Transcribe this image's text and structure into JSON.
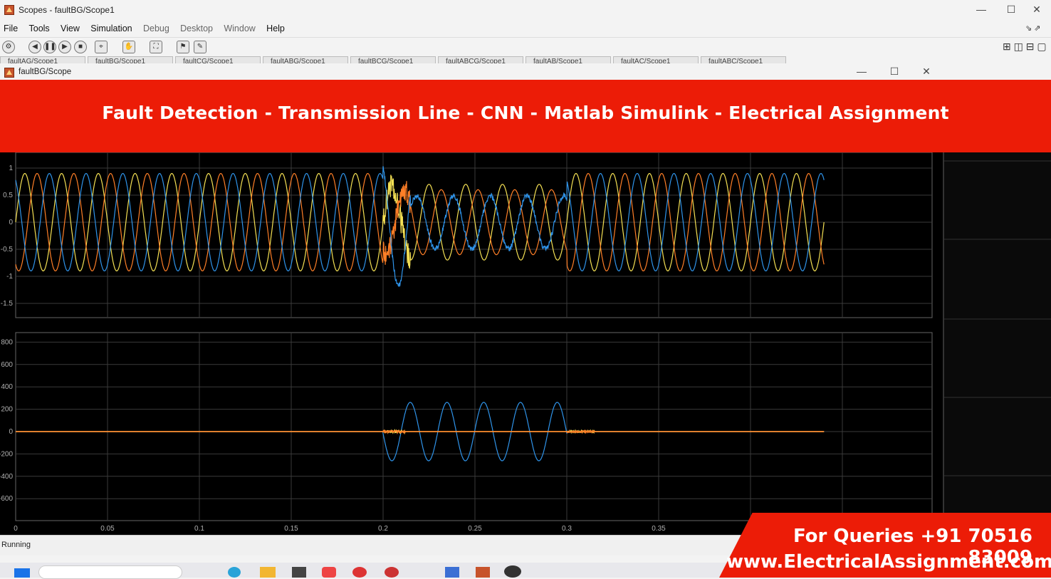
{
  "outer_window": {
    "title": "Scopes - faultBG/Scope1",
    "controls": {
      "minimize": "—",
      "maximize": "☐",
      "close": "✕"
    }
  },
  "menu": [
    "File",
    "Tools",
    "View",
    "Simulation",
    "Debug",
    "Desktop",
    "Window",
    "Help"
  ],
  "tabs": [
    "faultAG/Scope1",
    "faultBG/Scope1",
    "faultCG/Scope1",
    "faultABG/Scope1",
    "faultBCG/Scope1",
    "faultABCG/Scope1",
    "faultAB/Scope1",
    "faultAC/Scope1",
    "faultABC/Scope1"
  ],
  "inner_window": {
    "title": "faultBG/Scope",
    "controls": {
      "minimize": "—",
      "maximize": "☐",
      "close": "✕"
    }
  },
  "banner": {
    "text": "Fault Detection - Transmission Line - CNN - Matlab Simulink - Electrical Assignment"
  },
  "status": {
    "text": "Running"
  },
  "promo": {
    "line1": "For Queries +91 70516 83009",
    "line2": "www.ElectricalAssignment.com"
  },
  "colors": {
    "banner": "#ec1c07",
    "phase_a": "#f5e154",
    "phase_b": "#ff7f27",
    "phase_c": "#2f94ea"
  },
  "chart_data": [
    {
      "type": "line",
      "title": "",
      "xlabel": "",
      "ylabel": "",
      "xlim": [
        0,
        0.5
      ],
      "ylim": [
        -1.75,
        1.3
      ],
      "y_ticks": [
        "1",
        "0.5",
        "0",
        "-0.5",
        "-1",
        "-1.5"
      ],
      "signal": {
        "amplitude": 0.9,
        "frequency_hz": 50,
        "fault_start": 0.2,
        "fault_end": 0.3,
        "sim_end": 0.44
      },
      "series": [
        {
          "color": "#f5e154",
          "phase_deg": 0
        },
        {
          "color": "#ff7f27",
          "phase_deg": -120
        },
        {
          "color": "#2f94ea",
          "phase_deg": 120
        }
      ]
    },
    {
      "type": "line",
      "title": "",
      "xlabel": "",
      "ylabel": "",
      "xlim": [
        0,
        0.5
      ],
      "ylim": [
        -800,
        850
      ],
      "y_ticks": [
        "800",
        "600",
        "400",
        "200",
        "0",
        "-200",
        "-400",
        "-600"
      ],
      "x_ticks": [
        "0",
        "0.05",
        "0.1",
        "0.15",
        "0.2",
        "0.25",
        "0.3",
        "0.35"
      ],
      "signal": {
        "fault_amplitude": 250,
        "fault_offset": -20,
        "fault_start": 0.2,
        "fault_end": 0.3,
        "sim_end": 0.44
      },
      "series": [
        {
          "color": "#2f94ea",
          "phase_deg": 0
        },
        {
          "color": "#f5e154",
          "phase_deg": 0
        },
        {
          "color": "#ff7f27",
          "phase_deg": 0
        }
      ]
    }
  ]
}
